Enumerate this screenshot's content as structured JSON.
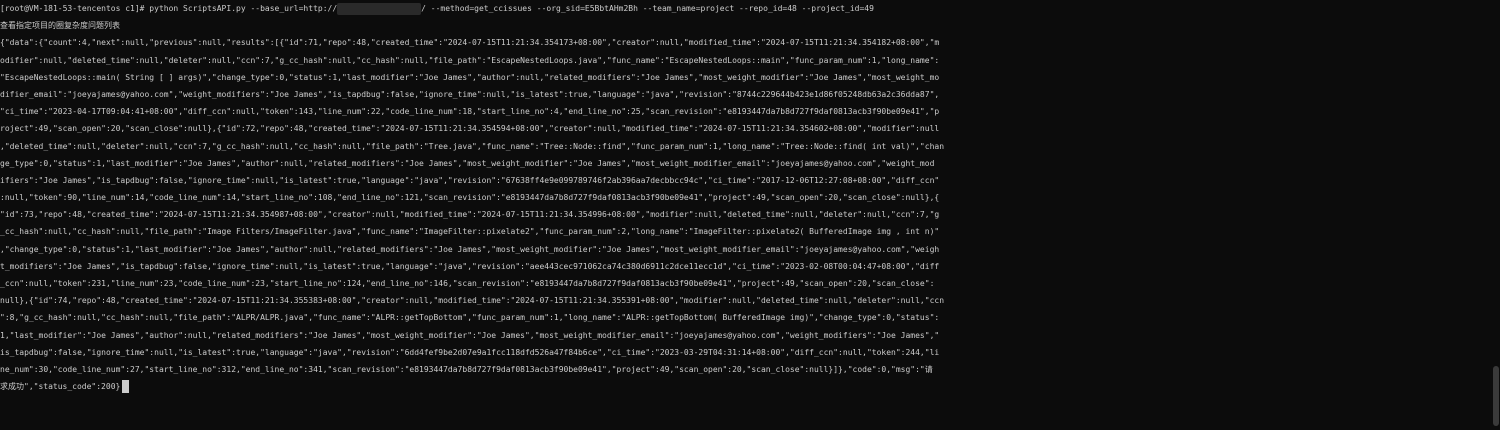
{
  "terminal": {
    "command": {
      "prefix": "[root@VM-181-53-tencentos c1]# python ScriptsAPI.py --base_url=http://",
      "suffix": "/ --method=get_ccissues --org_sid=E5BbtAHm2Bh --team_name=project --repo_id=48 --project_id=49"
    },
    "output_lines": [
      "查看指定项目的圈复杂度问题列表",
      "{\"data\":{\"count\":4,\"next\":null,\"previous\":null,\"results\":[{\"id\":71,\"repo\":48,\"created_time\":\"2024-07-15T11:21:34.354173+08:00\",\"creator\":null,\"modified_time\":\"2024-07-15T11:21:34.354182+08:00\",\"m",
      "odifier\":null,\"deleted_time\":null,\"deleter\":null,\"ccn\":7,\"g_cc_hash\":null,\"cc_hash\":null,\"file_path\":\"EscapeNestedLoops.java\",\"func_name\":\"EscapeNestedLoops::main\",\"func_param_num\":1,\"long_name\":",
      "\"EscapeNestedLoops::main( String [ ] args)\",\"change_type\":0,\"status\":1,\"last_modifier\":\"Joe James\",\"author\":null,\"related_modifiers\":\"Joe James\",\"most_weight_modifier\":\"Joe James\",\"most_weight_mo",
      "difier_email\":\"joeyajames@yahoo.com\",\"weight_modifiers\":\"Joe James\",\"is_tapdbug\":false,\"ignore_time\":null,\"is_latest\":true,\"language\":\"java\",\"revision\":\"8744c229644b423e1d86f05248db63a2c36dda87\",",
      "\"ci_time\":\"2023-04-17T09:04:41+08:00\",\"diff_ccn\":null,\"token\":143,\"line_num\":22,\"code_line_num\":18,\"start_line_no\":4,\"end_line_no\":25,\"scan_revision\":\"e8193447da7b8d727f9daf0813acb3f90be09e41\",\"p",
      "roject\":49,\"scan_open\":20,\"scan_close\":null},{\"id\":72,\"repo\":48,\"created_time\":\"2024-07-15T11:21:34.354594+08:00\",\"creator\":null,\"modified_time\":\"2024-07-15T11:21:34.354602+08:00\",\"modifier\":null",
      ",\"deleted_time\":null,\"deleter\":null,\"ccn\":7,\"g_cc_hash\":null,\"cc_hash\":null,\"file_path\":\"Tree.java\",\"func_name\":\"Tree::Node::find\",\"func_param_num\":1,\"long_name\":\"Tree::Node::find( int val)\",\"chan",
      "ge_type\":0,\"status\":1,\"last_modifier\":\"Joe James\",\"author\":null,\"related_modifiers\":\"Joe James\",\"most_weight_modifier\":\"Joe James\",\"most_weight_modifier_email\":\"joeyajames@yahoo.com\",\"weight_mod",
      "ifiers\":\"Joe James\",\"is_tapdbug\":false,\"ignore_time\":null,\"is_latest\":true,\"language\":\"java\",\"revision\":\"67638ff4e9e099789746f2ab396aa7decbbcc94c\",\"ci_time\":\"2017-12-06T12:27:08+08:00\",\"diff_ccn\"",
      ":null,\"token\":90,\"line_num\":14,\"code_line_num\":14,\"start_line_no\":108,\"end_line_no\":121,\"scan_revision\":\"e8193447da7b8d727f9daf0813acb3f90be09e41\",\"project\":49,\"scan_open\":20,\"scan_close\":null},{",
      "\"id\":73,\"repo\":48,\"created_time\":\"2024-07-15T11:21:34.354987+08:00\",\"creator\":null,\"modified_time\":\"2024-07-15T11:21:34.354996+08:00\",\"modifier\":null,\"deleted_time\":null,\"deleter\":null,\"ccn\":7,\"g",
      "_cc_hash\":null,\"cc_hash\":null,\"file_path\":\"Image Filters/ImageFilter.java\",\"func_name\":\"ImageFilter::pixelate2\",\"func_param_num\":2,\"long_name\":\"ImageFilter::pixelate2( BufferedImage img , int n)\"",
      ",\"change_type\":0,\"status\":1,\"last_modifier\":\"Joe James\",\"author\":null,\"related_modifiers\":\"Joe James\",\"most_weight_modifier\":\"Joe James\",\"most_weight_modifier_email\":\"joeyajames@yahoo.com\",\"weigh",
      "t_modifiers\":\"Joe James\",\"is_tapdbug\":false,\"ignore_time\":null,\"is_latest\":true,\"language\":\"java\",\"revision\":\"aee443cec971062ca74c380d6911c2dce11ecc1d\",\"ci_time\":\"2023-02-08T00:04:47+08:00\",\"diff",
      "_ccn\":null,\"token\":231,\"line_num\":23,\"code_line_num\":23,\"start_line_no\":124,\"end_line_no\":146,\"scan_revision\":\"e8193447da7b8d727f9daf0813acb3f90be09e41\",\"project\":49,\"scan_open\":20,\"scan_close\":",
      "null},{\"id\":74,\"repo\":48,\"created_time\":\"2024-07-15T11:21:34.355383+08:00\",\"creator\":null,\"modified_time\":\"2024-07-15T11:21:34.355391+08:00\",\"modifier\":null,\"deleted_time\":null,\"deleter\":null,\"ccn",
      "\":8,\"g_cc_hash\":null,\"cc_hash\":null,\"file_path\":\"ALPR/ALPR.java\",\"func_name\":\"ALPR::getTopBottom\",\"func_param_num\":1,\"long_name\":\"ALPR::getTopBottom( BufferedImage img)\",\"change_type\":0,\"status\":",
      "1,\"last_modifier\":\"Joe James\",\"author\":null,\"related_modifiers\":\"Joe James\",\"most_weight_modifier\":\"Joe James\",\"most_weight_modifier_email\":\"joeyajames@yahoo.com\",\"weight_modifiers\":\"Joe James\",\"",
      "is_tapdbug\":false,\"ignore_time\":null,\"is_latest\":true,\"language\":\"java\",\"revision\":\"6dd4fef9be2d07e9a1fcc118dfd526a47f84b6ce\",\"ci_time\":\"2023-03-29T04:31:14+08:00\",\"diff_ccn\":null,\"token\":244,\"li",
      "ne_num\":30,\"code_line_num\":27,\"start_line_no\":312,\"end_line_no\":341,\"scan_revision\":\"e8193447da7b8d727f9daf0813acb3f90be09e41\",\"project\":49,\"scan_open\":20,\"scan_close\":null}]},\"code\":0,\"msg\":\"请",
      "求成功\",\"status_code\":200}"
    ]
  }
}
